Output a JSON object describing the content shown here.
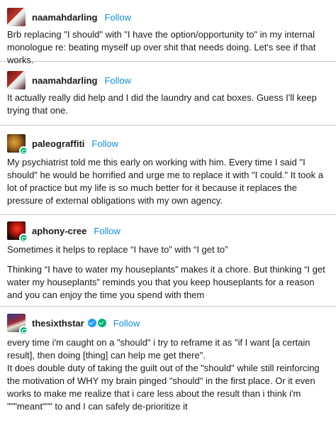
{
  "posts": [
    {
      "username": "naamahdarling",
      "follow_label": "Follow",
      "avatar_icon": "dog-avatar",
      "reblog_badge": false,
      "paragraphs": [
        "Brb replacing \"I should\" with \"I have the option/opportunity to\" in my internal monologue re: beating myself up over shit that needs doing. Let's see if that works."
      ]
    },
    {
      "username": "naamahdarling",
      "follow_label": "Follow",
      "avatar_icon": "dog-avatar",
      "reblog_badge": false,
      "paragraphs": [
        "It actually really did help and I did the laundry and cat boxes. Guess I'll keep trying that one."
      ]
    },
    {
      "username": "paleograffiti",
      "follow_label": "Follow",
      "avatar_icon": "creature-avatar",
      "reblog_badge": true,
      "paragraphs": [
        "My psychiatrist told me this early on working with him. Every time I said \"I should\" he would be horrified and urge me to replace it with \"I could.\" It took a lot of practice but my life is so much better for it because it replaces the pressure of external obligations with my own agency."
      ]
    },
    {
      "username": "aphony-cree",
      "follow_label": "Follow",
      "avatar_icon": "fire-avatar",
      "reblog_badge": true,
      "paragraphs": [
        "Sometimes it helps to replace “I have to” with “I get to”",
        "Thinking “I have to water my houseplants” makes it a chore. But thinking “I get water my houseplants” reminds you that you keep houseplants for a reason and you can enjoy the time you spend with them"
      ]
    },
    {
      "username": "thesixthstar",
      "follow_label": "Follow",
      "avatar_icon": "character-avatar",
      "reblog_badge": true,
      "verified_icons": [
        "blue-check-icon",
        "green-check-icon"
      ],
      "paragraphs": [
        "every time i'm caught on a \"should\" i try to reframe it as \"if I want [a certain result], then doing [thing] can help me get there\".",
        "It does double duty of taking the guilt out of the \"should\" while still reinforcing the motivation of WHY my brain pinged \"should\" in the first place. Or it even works to make me realize that i care less about the result than i think i'm \"\"\"meant\"\"\" to and I can safely de-prioritize it"
      ]
    }
  ],
  "colors": {
    "follow_link": "#0d8ed9",
    "text": "#1a1a1a",
    "divider": "#c7c7c7",
    "reblog_badge": "#00b37a",
    "verified_blue": "#1d9bf0"
  }
}
